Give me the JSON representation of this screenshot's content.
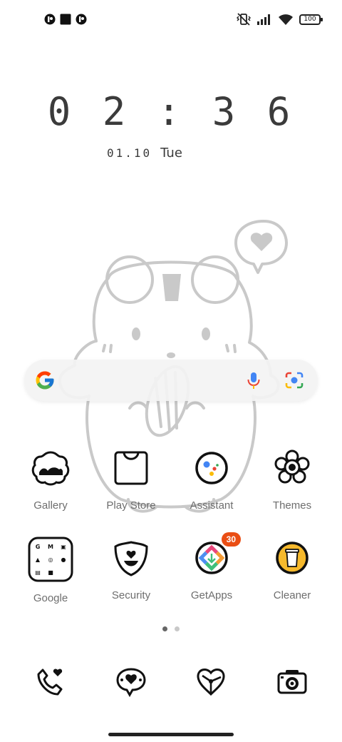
{
  "status_bar": {
    "left_icons": [
      "app-notification-icon",
      "square-notification-icon",
      "app-notification-icon"
    ],
    "right_icons": [
      "vibrate-off-icon",
      "signal-icon",
      "wifi-icon"
    ],
    "battery": "100"
  },
  "lockscreen": {
    "time": "0 2 : 3 6",
    "date": "01.10",
    "weekday": "Tue"
  },
  "search": {
    "logo": "google-logo-icon",
    "mic": "microphone-icon",
    "lens": "lens-camera-icon"
  },
  "apps": [
    {
      "label": "Gallery"
    },
    {
      "label": "Play Store"
    },
    {
      "label": "Assistant"
    },
    {
      "label": "Themes"
    },
    {
      "label": "Google"
    },
    {
      "label": "Security"
    },
    {
      "label": "GetApps",
      "badge": "30"
    },
    {
      "label": "Cleaner"
    }
  ],
  "dock": [
    "phone-icon",
    "messages-icon",
    "browser-icon",
    "camera-icon"
  ],
  "pages": {
    "count": 2,
    "active": 1
  },
  "colors": {
    "badge": "#ea4e14",
    "line": "#c9c9c9"
  }
}
